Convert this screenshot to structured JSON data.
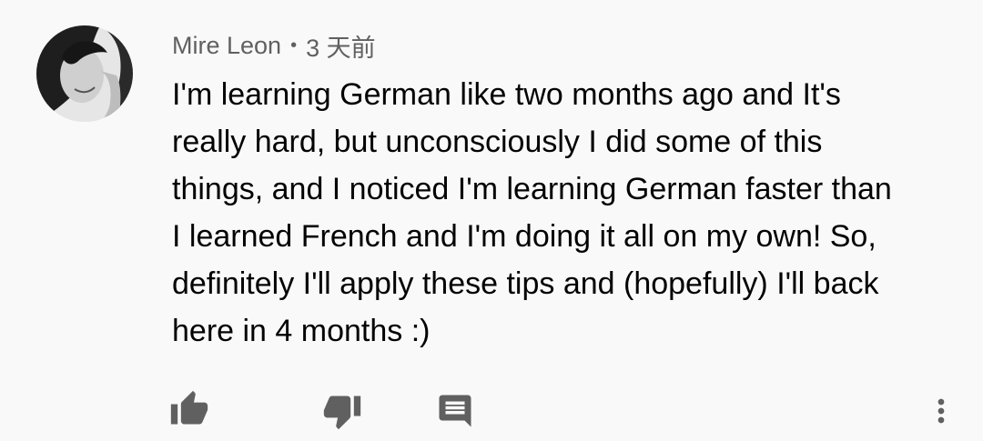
{
  "comment": {
    "author": "Mire Leon",
    "separator": "•",
    "time": "3 天前",
    "text": "I'm learning German like two months ago and It's\nreally hard, but unconsciously I did some of this\nthings, and I noticed I'm learning German faster than\nI learned French and I'm doing it all on my own! So,\ndefinitely I'll apply these tips and (hopefully) I'll back\nhere in 4 months :)"
  },
  "actions": {
    "like_icon": "thumb-up-icon",
    "dislike_icon": "thumb-down-icon",
    "reply_icon": "comment-icon",
    "more_icon": "more-vertical-icon"
  },
  "colors": {
    "background": "#f9f9f9",
    "meta_text": "#606060",
    "body_text": "#030303",
    "icon": "#606060"
  }
}
